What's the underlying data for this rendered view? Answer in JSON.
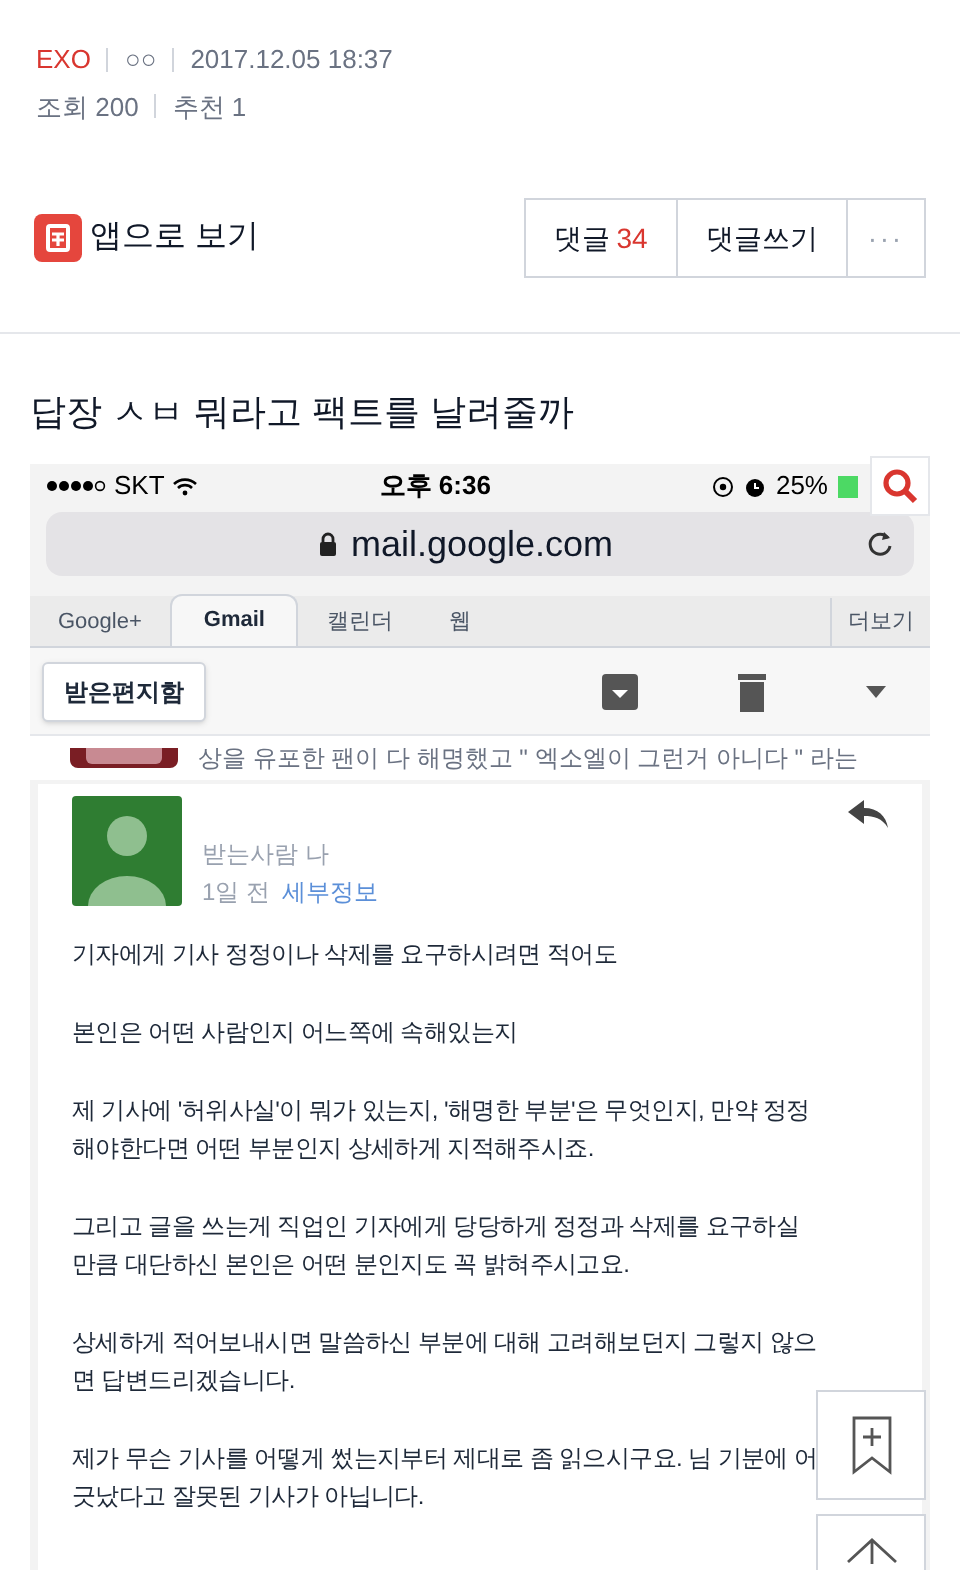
{
  "post": {
    "author": "EXO",
    "category": "○○",
    "date": "2017.12.05 18:37",
    "views": "조회 200",
    "recommends": "추천 1"
  },
  "app_link": {
    "label": "앱으로 보기"
  },
  "actions": {
    "comments_label": "댓글",
    "comments_count": "34",
    "write": "댓글쓰기",
    "more": "···"
  },
  "title": "답장 ㅅㅂ 뭐라고 팩트를 날려줄까",
  "screenshot": {
    "status_bar": {
      "carrier": "SKT",
      "time": "오후 6:36",
      "battery": "25%"
    },
    "url": "mail.google.com",
    "tabs": [
      {
        "label": "Google+",
        "selected": false
      },
      {
        "label": "Gmail",
        "selected": true
      },
      {
        "label": "캘린더",
        "selected": false
      },
      {
        "label": "웹",
        "selected": false
      }
    ],
    "more_tab": "더보기",
    "back": "받은편지함",
    "preview_text": "상을 유포한 팬이 다 해명했고 \" 엑소엘이 그런거 아니다 \" 라는",
    "email": {
      "recipient": "받는사람 나",
      "time": "1일 전",
      "details": "세부정보",
      "paragraphs": [
        "기자에게 기사 정정이나 삭제를 요구하시려면 적어도",
        "본인은 어떤 사람인지 어느쪽에 속해있는지",
        "제 기사에 '허위사실'이 뭐가 있는지, '해명한 부분'은 무엇인지, 만약 정정해야한다면 어떤 부분인지 상세하게 지적해주시죠.",
        "그리고 글을 쓰는게 직업인 기자에게 당당하게 정정과 삭제를 요구하실 만큼 대단하신 본인은 어떤 분인지도 꼭 밝혀주시고요.",
        "상세하게 적어보내시면 말씀하신 부분에 대해 고려해보던지 그렇지 않으면 답변드리겠습니다.",
        "제가 무슨 기사를 어떻게 썼는지부터 제대로 좀 읽으시구요. 님 기분에 어긋났다고 잘못된 기사가 아닙니다."
      ]
    }
  }
}
